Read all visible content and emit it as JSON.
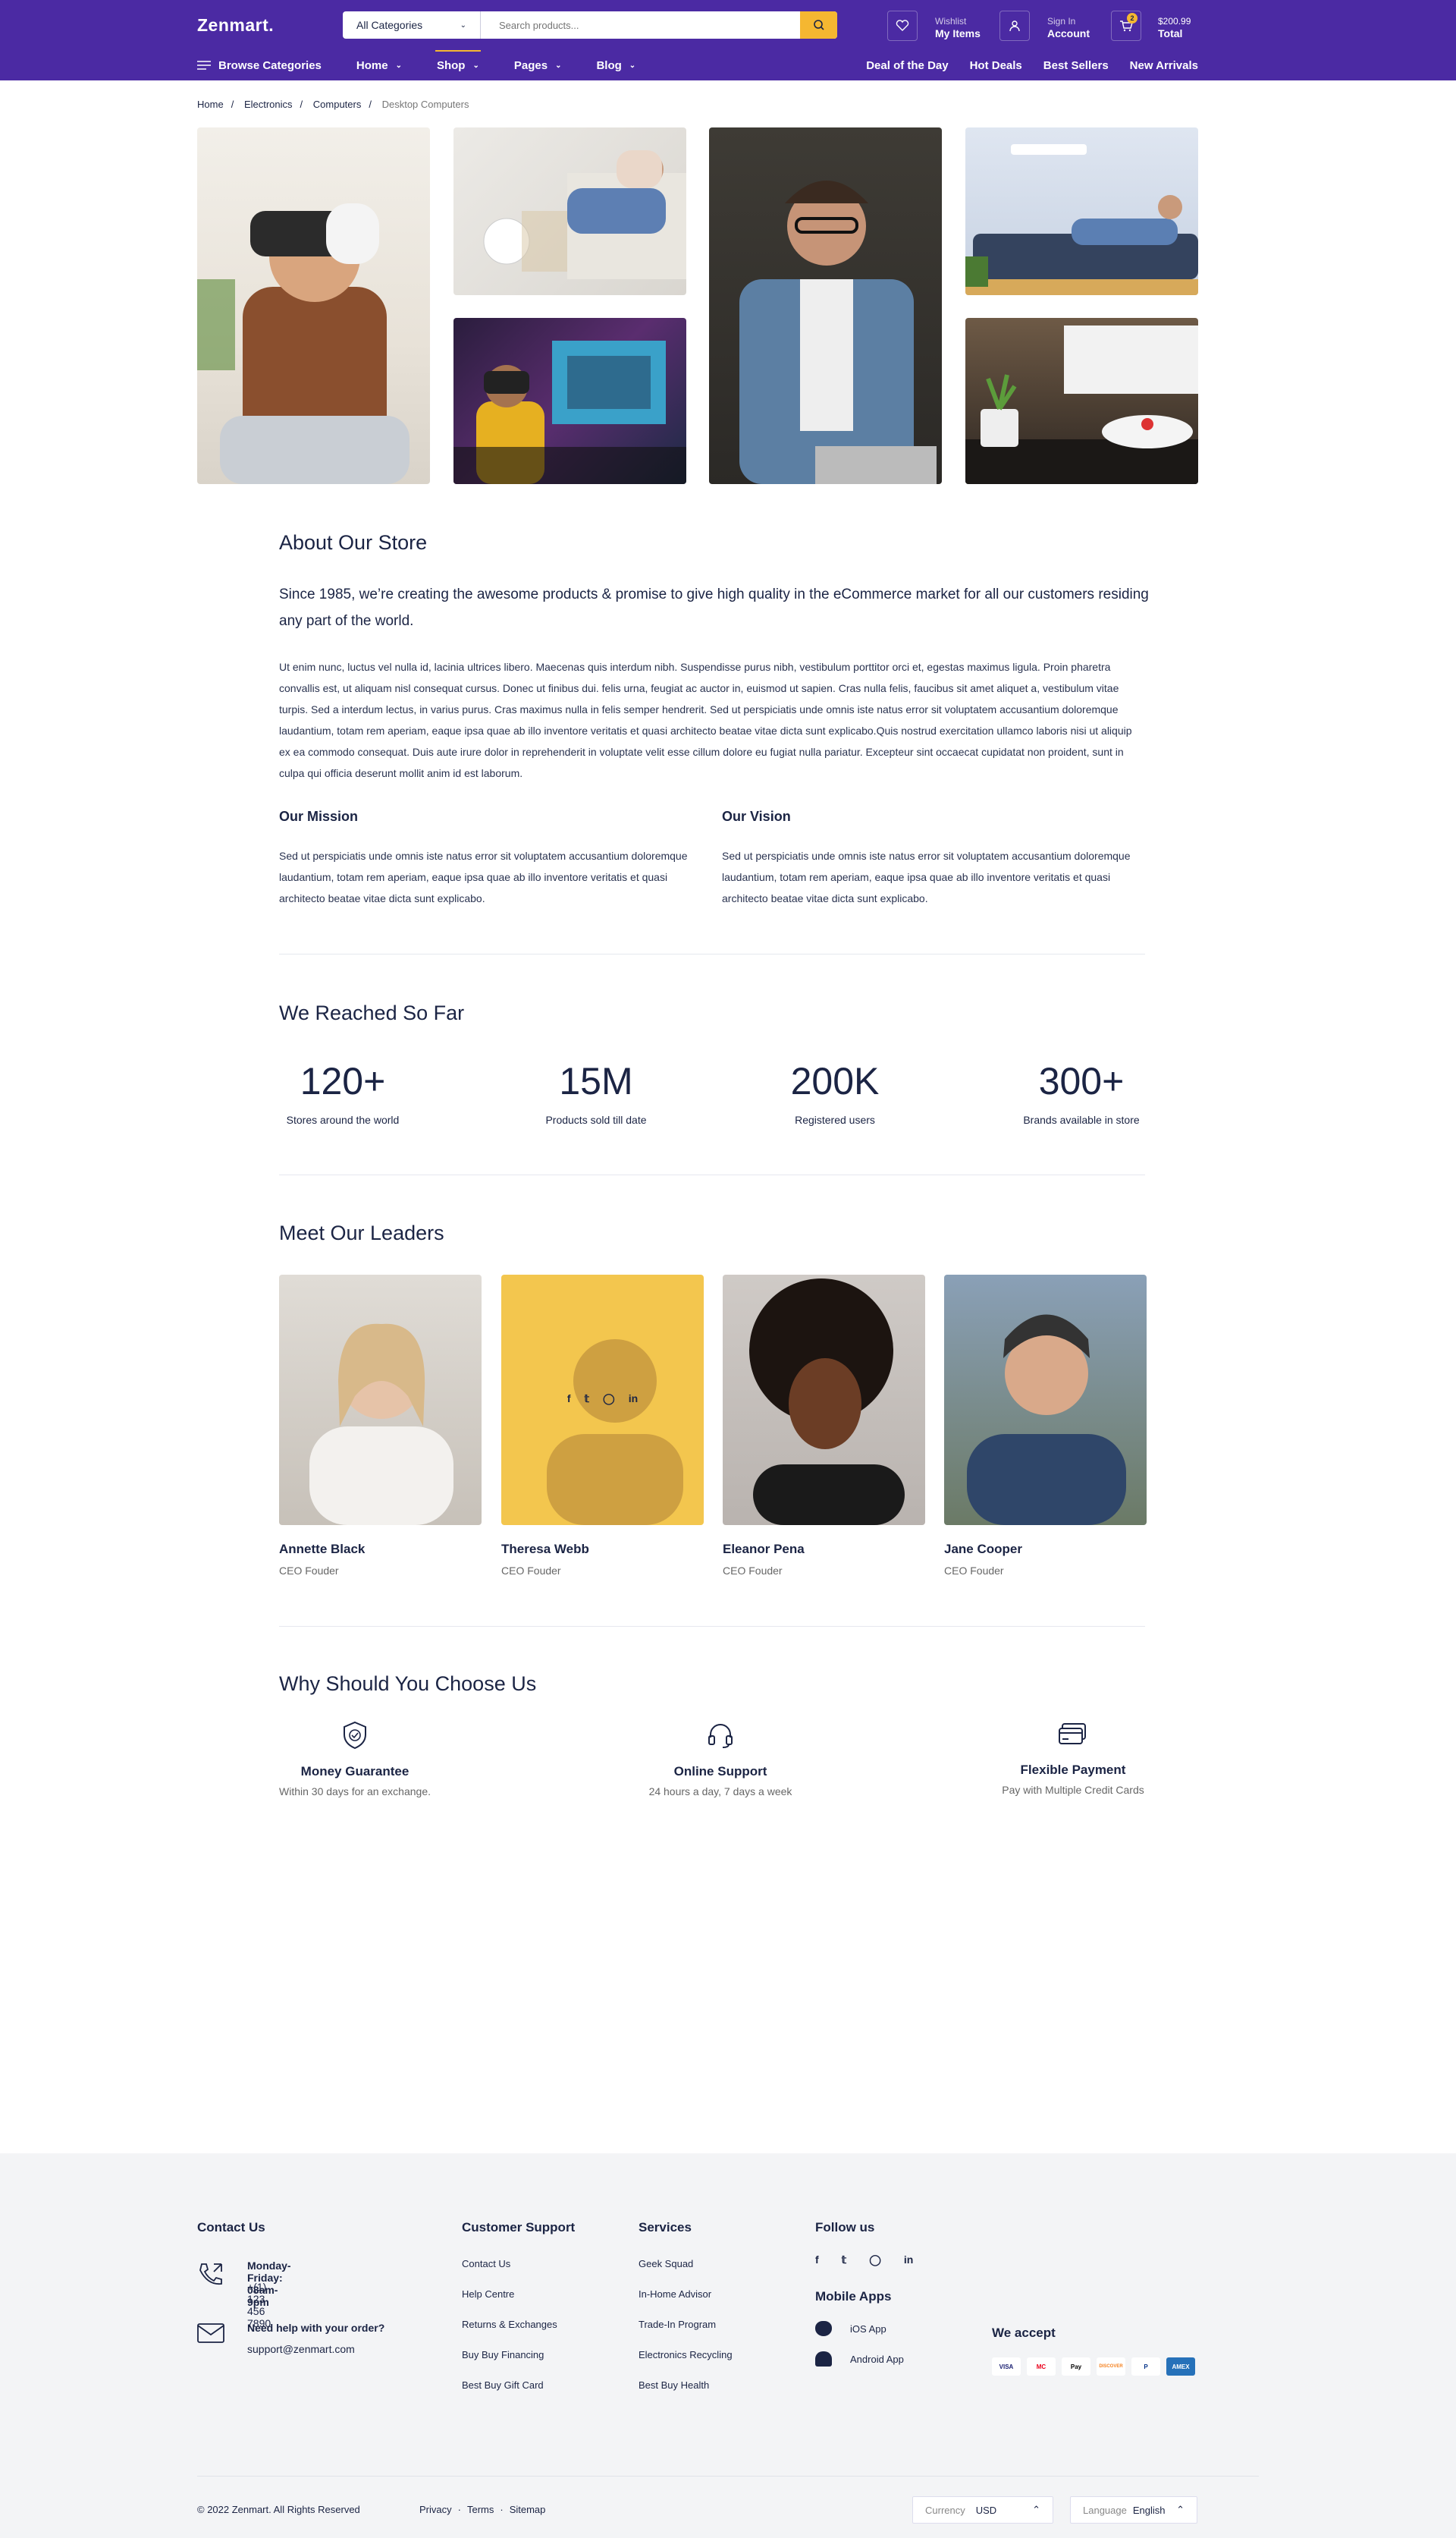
{
  "header": {
    "logo": "Zenmart.",
    "category": "All Categories",
    "search_placeholder": "Search products...",
    "wishlist_small": "Wishlist",
    "wishlist_big": "My Items",
    "account_small": "Sign In",
    "account_big": "Account",
    "cart_count": "2",
    "cart_price": "$200.99",
    "cart_total": "Total"
  },
  "nav": {
    "browse": "Browse Categories",
    "items": [
      "Home",
      "Shop",
      "Pages",
      "Blog"
    ],
    "right": [
      "Deal of the Day",
      "Hot Deals",
      "Best Sellers",
      "New Arrivals"
    ]
  },
  "breadcrumb": [
    "Home",
    "Electronics",
    "Computers",
    "Desktop Computers"
  ],
  "about": {
    "title": "About Our Store",
    "lead": "Since 1985, we’re creating the awesome products & promise to give high quality in the eCommerce market for all our customers residing any part of the world.",
    "body": "Ut enim nunc, luctus vel nulla id, lacinia ultrices libero. Maecenas quis interdum nibh. Suspendisse purus nibh, vestibulum porttitor orci et, egestas maximus ligula. Proin pharetra convallis est, ut aliquam nisl consequat cursus. Donec ut finibus dui. felis urna, feugiat ac auctor in, euismod ut sapien. Cras nulla felis, faucibus sit amet aliquet a, vestibulum vitae turpis. Sed a interdum lectus, in varius purus. Cras maximus nulla in felis semper hendrerit. Sed ut perspiciatis unde omnis iste natus error sit voluptatem accusantium doloremque laudantium, totam rem aperiam, eaque ipsa quae ab illo inventore veritatis et quasi architecto beatae vitae dicta sunt explicabo.Quis nostrud exercitation ullamco laboris nisi ut aliquip ex ea commodo consequat. Duis aute irure dolor in reprehenderit in voluptate velit esse cillum dolore eu fugiat nulla pariatur. Excepteur sint occaecat cupidatat non proident, sunt in culpa qui officia deserunt mollit anim id est laborum.",
    "mission_title": "Our Mission",
    "mission": "Sed ut perspiciatis unde omnis iste natus error sit voluptatem accusantium doloremque laudantium, totam rem aperiam, eaque ipsa quae ab illo inventore veritatis et quasi architecto beatae vitae dicta sunt explicabo.",
    "vision_title": "Our Vision",
    "vision": "Sed ut perspiciatis unde omnis iste natus error sit voluptatem accusantium doloremque laudantium, totam rem aperiam, eaque ipsa quae ab illo inventore veritatis et quasi architecto beatae vitae dicta sunt explicabo."
  },
  "reached": {
    "title": "We Reached So Far",
    "stats": [
      {
        "n": "120+",
        "l": "Stores around the world"
      },
      {
        "n": "15M",
        "l": "Products sold till date"
      },
      {
        "n": "200K",
        "l": "Registered users"
      },
      {
        "n": "300+",
        "l": "Brands available in store"
      }
    ]
  },
  "leaders": {
    "title": "Meet Our Leaders",
    "people": [
      {
        "name": "Annette Black",
        "role": "CEO Fouder"
      },
      {
        "name": "Theresa Webb",
        "role": "CEO Fouder"
      },
      {
        "name": "Eleanor Pena",
        "role": "CEO Fouder"
      },
      {
        "name": "Jane Cooper",
        "role": "CEO Fouder"
      }
    ],
    "social": [
      "f",
      "t",
      "ig",
      "in"
    ]
  },
  "why": {
    "title": "Why Should You Choose Us",
    "items": [
      {
        "t": "Money Guarantee",
        "d": "Within 30 days for an exchange."
      },
      {
        "t": "Online Support",
        "d": "24 hours a day, 7 days a week"
      },
      {
        "t": "Flexible Payment",
        "d": "Pay with Multiple Credit Cards"
      }
    ]
  },
  "footer": {
    "contact_title": "Contact Us",
    "hours": "Monday-Friday: 08am-9pm",
    "phone": "+(1) 123 456 7890",
    "help": "Need help with your order?",
    "email": "support@zenmart.com",
    "support_title": "Customer Support",
    "support": [
      "Contact Us",
      "Help Centre",
      "Returns & Exchanges",
      "Buy Buy Financing",
      "Best Buy Gift Card"
    ],
    "services_title": "Services",
    "services": [
      "Geek Squad",
      "In-Home Advisor",
      "Trade-In Program",
      "Electronics Recycling",
      "Best Buy Health"
    ],
    "follow_title": "Follow us",
    "apps_title": "Mobile Apps",
    "ios": "iOS App",
    "android": "Android App",
    "accept_title": "We accept",
    "cards": [
      "VISA",
      "MC",
      "Pay",
      "DISCOVER",
      "P",
      "AMEX"
    ],
    "copyright": "© 2022 Zenmart. All Rights Reserved",
    "links": [
      "Privacy",
      "Terms",
      "Sitemap"
    ],
    "currency_label": "Currency",
    "currency": "USD",
    "language_label": "Language",
    "language": "English"
  },
  "colors": {
    "brand": "#4b2aa3",
    "accent": "#f5b731",
    "text": "#1b2444"
  }
}
